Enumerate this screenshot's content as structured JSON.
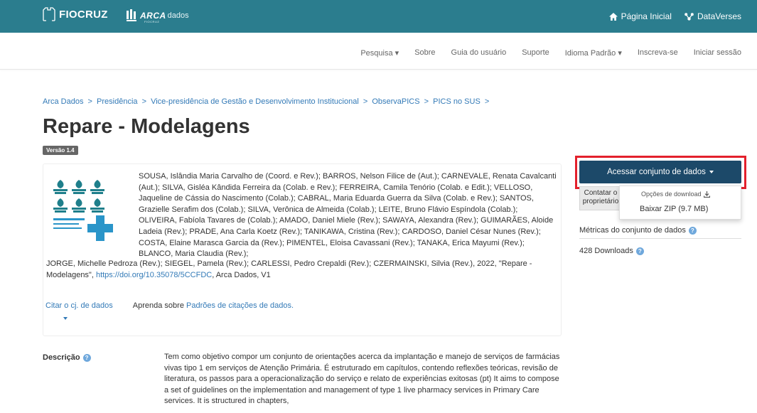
{
  "header": {
    "fiocruz_logo": "FIOCRUZ",
    "arca_logo_word": "ARCA",
    "arca_logo_word2": "dados",
    "arca_logo_sub": "FIOCRUZ",
    "home_link": "Página Inicial",
    "dataverses_link": "DataVerses",
    "brand_color": "#2b7d8e"
  },
  "nav": {
    "items": [
      "Pesquisa ▾",
      "Sobre",
      "Guia do usuário",
      "Suporte",
      "Idioma Padrão ▾",
      "Inscreva-se",
      "Iniciar sessão"
    ]
  },
  "breadcrumb": {
    "items": [
      "Arca Dados",
      "Presidência",
      "Vice-presidência de Gestão e Desenvolvimento Institucional",
      "ObservaPICS",
      "PICS no SUS"
    ],
    "separator": ">"
  },
  "dataset": {
    "title": "Repare - Modelagens",
    "version": "Versão 1.4",
    "citation_part1": "SOUSA, Islândia Maria Carvalho de (Coord. e Rev.); BARROS, Nelson Filice de (Aut.); CARNEVALE, Renata Cavalcanti (Aut.); SILVA, Gisléa Kândida Ferreira da (Colab. e Rev.); FERREIRA, Camila Tenório (Colab. e Edit.); VELLOSO, Jaqueline de Cássia do Nascimento (Colab.); CABRAL, Maria Eduarda Guerra da Silva (Colab. e Rev.); SANTOS, Grazielle Serafim dos (Colab.); SILVA, Verônica de Almeida (Colab.); LEITE, Bruno Flávio Espíndola (Colab.); OLIVEIRA, Fabíola Tavares de (Colab.); AMADO, Daniel Miele (Rev.); SAWAYA, Alexandra (Rev.); GUIMARÃES, Aloide Ladeia (Rev.); PRADE, Ana Carla Koetz (Rev.); TANIKAWA, Cristina (Rev.); CARDOSO, Daniel César Nunes (Rev.); COSTA, Elaine Marasca Garcia da (Rev.); PIMENTEL, Eloisa Cavassani (Rev.); TANAKA, Erica Mayumi (Rev.); BLANCO, Maria Claudia (Rev.);",
    "citation_part2": "JORGE, Michelle Pedroza (Rev.); SIEGEL, Pamela (Rev.); CARLESSI, Pedro Crepaldi (Rev.); CZERMAINSKI, Silvia (Rev.), 2022, \"Repare - Modelagens\", ",
    "doi_link": "https://doi.org/10.35078/5CCFDC",
    "citation_suffix": ", Arca Dados, V1",
    "cite_dataset": "Citar o cj. de dados",
    "learn_prefix": "Aprenda sobre ",
    "learn_link": "Padrões de citações de dados.",
    "access_button": "Acessar conjunto de dados",
    "contact_button": "Contatar o proprietário",
    "download_options": "Opções de download",
    "download_zip": "Baixar ZIP (9.7 MB)",
    "metrics_title": "Métricas do conjunto de dados",
    "downloads": "428 Downloads",
    "description_label": "Descrição",
    "description": "Tem como objetivo compor um conjunto de orientações acerca da implantação e manejo de serviços de farmácias vivas tipo 1 em serviços de Atenção Primária. É estruturado em capítulos, contendo reflexões teóricas, revisão de literatura, os passos para a operacionalização do serviço e relato de experiências exitosas (pt) It aims to compose a set of guidelines on the implementation and management of type 1 live pharmacy services in Primary Care services. It is structured in chapters,"
  },
  "colors": {
    "access_button": "#1c4969",
    "highlight": "#e3202c",
    "link": "#337ab7"
  }
}
